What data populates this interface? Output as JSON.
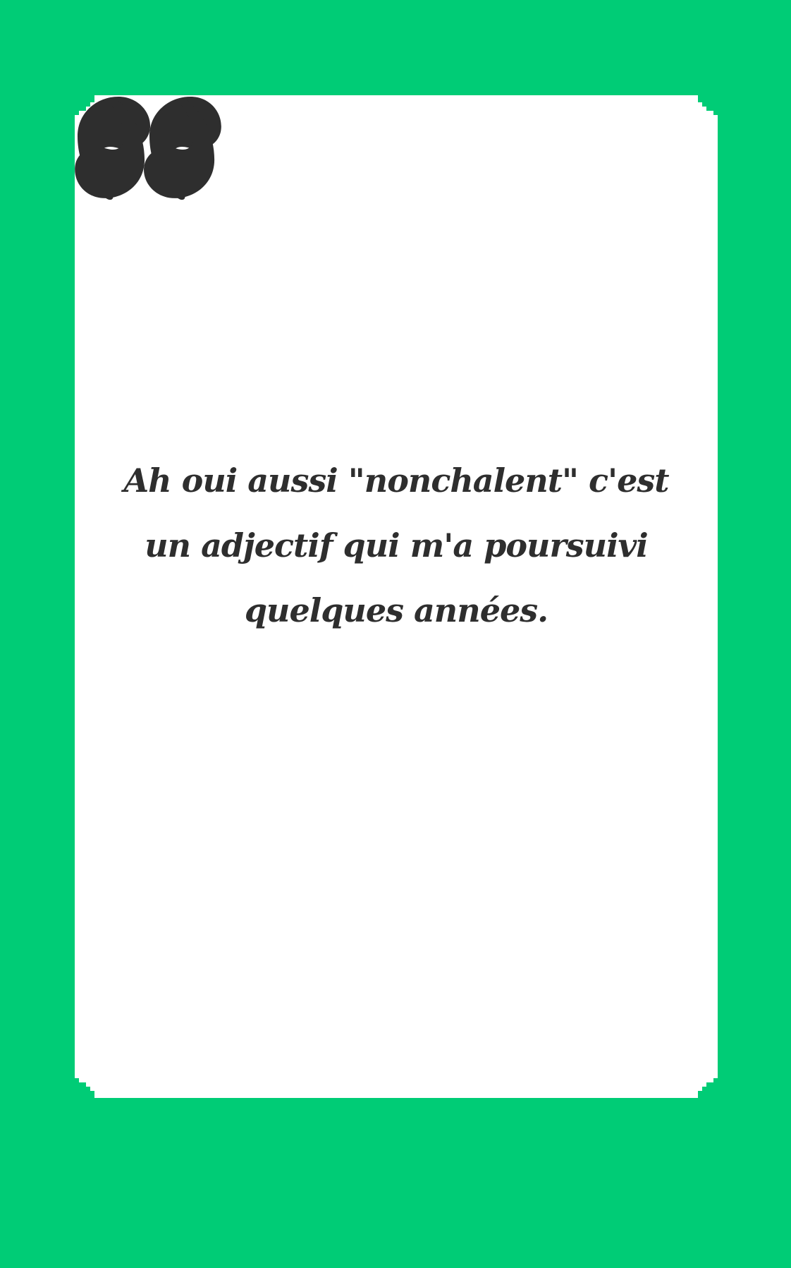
{
  "quote": {
    "text": "Ah oui aussi \"nonchalent\" c'est un adjectif qui m'a poursuivi quelques années."
  },
  "colors": {
    "background": "#00CC76",
    "card": "#FFFFFF",
    "text": "#2E2E2E"
  },
  "icons": {
    "open": "open-quote-icon",
    "close": "close-quote-icon"
  }
}
